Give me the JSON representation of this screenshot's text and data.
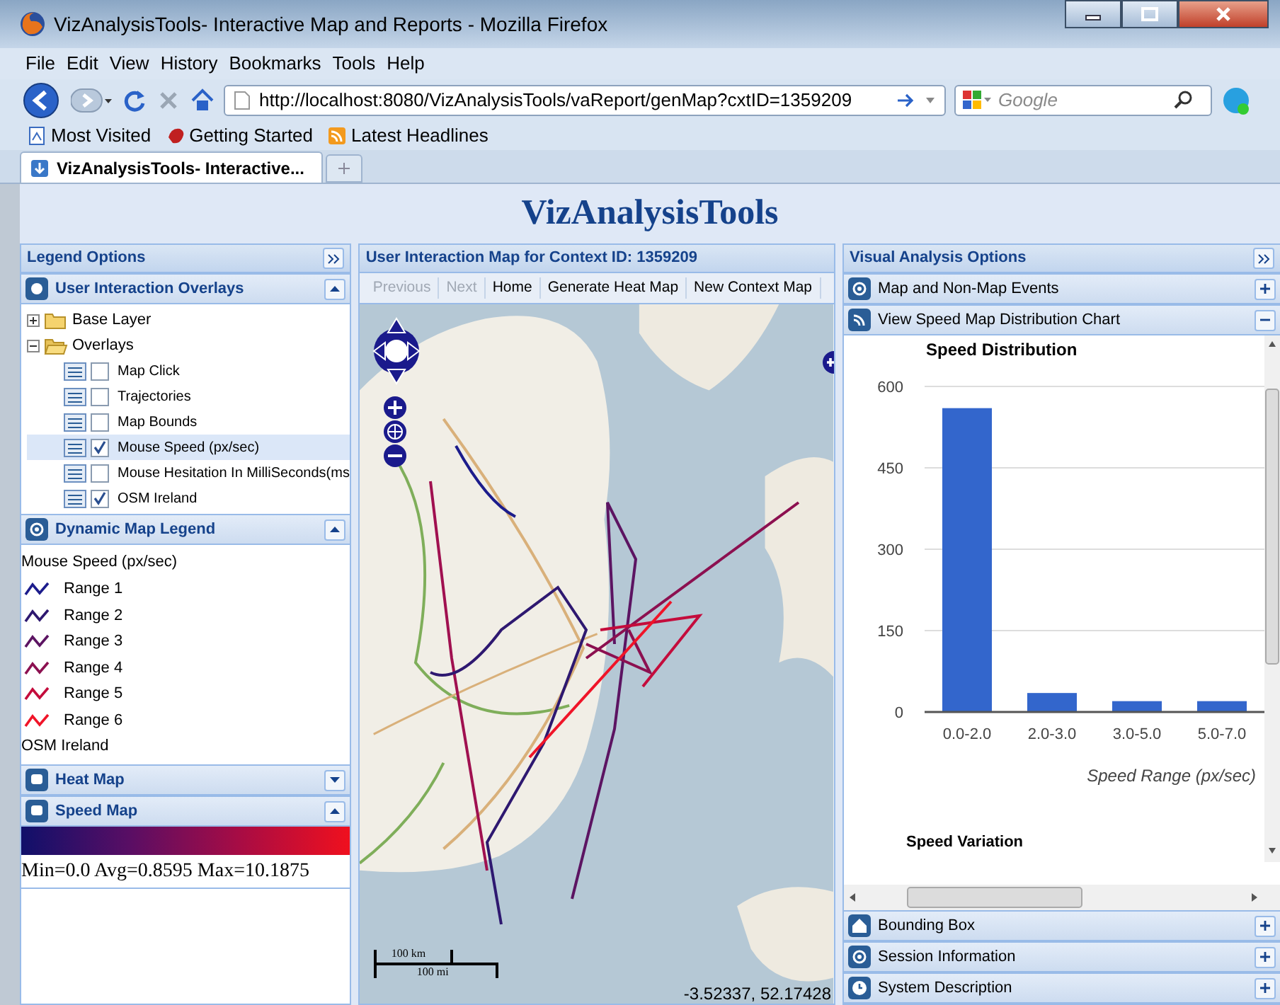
{
  "window": {
    "title": "VizAnalysisTools- Interactive Map and Reports - Mozilla Firefox"
  },
  "menu": [
    "File",
    "Edit",
    "View",
    "History",
    "Bookmarks",
    "Tools",
    "Help"
  ],
  "address_bar": {
    "url": "http://localhost:8080/VizAnalysisTools/vaReport/genMap?cxtID=1359209"
  },
  "search": {
    "placeholder": "Google"
  },
  "bookmarks": [
    "Most Visited",
    "Getting Started",
    "Latest Headlines"
  ],
  "tabs": [
    {
      "label": "VizAnalysisTools- Interactive...",
      "selected": true
    }
  ],
  "page": {
    "title": "VizAnalysisTools"
  },
  "left_panel": {
    "title": "Legend Options",
    "overlays": {
      "title": "User Interaction Overlays",
      "expanded": true,
      "tree": [
        {
          "label": "Base Layer",
          "expanded": false
        },
        {
          "label": "Overlays",
          "expanded": true,
          "children": [
            {
              "label": "Map Click",
              "checked": false,
              "selected": false
            },
            {
              "label": "Trajectories",
              "checked": false,
              "selected": false
            },
            {
              "label": "Map Bounds",
              "checked": false,
              "selected": false
            },
            {
              "label": "Mouse Speed (px/sec)",
              "checked": true,
              "selected": true
            },
            {
              "label": "Mouse Hesitation In MilliSeconds(ms",
              "checked": false,
              "selected": false
            },
            {
              "label": "OSM Ireland",
              "checked": true,
              "selected": false
            }
          ]
        }
      ]
    },
    "map_legend": {
      "title": "Dynamic Map Legend",
      "expanded": true,
      "heading": "Mouse Speed (px/sec)",
      "ranges": [
        {
          "label": "Range 1",
          "color": "#1c1c8c"
        },
        {
          "label": "Range 2",
          "color": "#2e1870"
        },
        {
          "label": "Range 3",
          "color": "#5c1462"
        },
        {
          "label": "Range 4",
          "color": "#8c1050"
        },
        {
          "label": "Range 5",
          "color": "#c40c3c"
        },
        {
          "label": "Range 6",
          "color": "#f01428"
        }
      ],
      "footer": "OSM Ireland"
    },
    "heat_map": {
      "title": "Heat Map",
      "expanded": false
    },
    "speed_map": {
      "title": "Speed Map",
      "expanded": true,
      "stats": "Min=0.0 Avg=0.8595 Max=10.1875"
    }
  },
  "map_panel": {
    "title": "User Interaction Map for Context ID: 1359209",
    "toolbar": [
      {
        "label": "Previous",
        "disabled": true
      },
      {
        "label": "Next",
        "disabled": true
      },
      {
        "label": "Home",
        "disabled": false
      },
      {
        "label": "Generate Heat Map",
        "disabled": false
      },
      {
        "label": "New Context Map",
        "disabled": false
      }
    ],
    "scale": [
      "100 km",
      "100 mi"
    ],
    "coordinates": "-3.52337, 52.17428"
  },
  "right_panel": {
    "title": "Visual Analysis Options",
    "sections": [
      {
        "title": "Map and Non-Map Events",
        "expanded": false
      },
      {
        "title": "View Speed Map Distribution Chart",
        "expanded": true,
        "subheading": "Speed Variation",
        "chart_data": {
          "type": "bar",
          "title": "Speed Distribution",
          "xlabel": "Speed Range (px/sec)",
          "categories": [
            "0.0-2.0",
            "2.0-3.0",
            "3.0-5.0",
            "5.0-7.0"
          ],
          "series": [
            {
              "color": "#3366cc",
              "values": [
                560,
                35,
                20,
                20
              ]
            }
          ],
          "ylim": [
            0,
            600
          ],
          "yticks": [
            0,
            150,
            300,
            450,
            600
          ],
          "grid": true
        }
      },
      {
        "title": "Bounding Box",
        "expanded": false
      },
      {
        "title": "Session Information",
        "expanded": false
      },
      {
        "title": "System Description",
        "expanded": false
      }
    ]
  }
}
